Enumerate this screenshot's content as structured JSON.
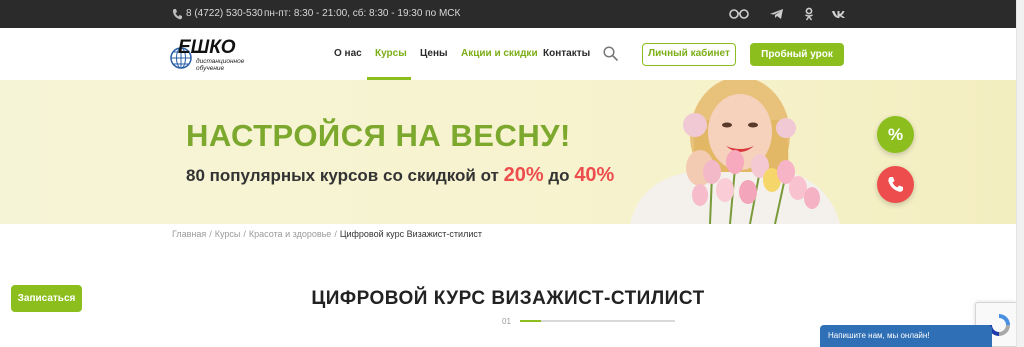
{
  "topbar": {
    "phone": "8 (4722) 530-530",
    "hours": "пн-пт: 8:30 - 21:00, сб: 8:30 - 19:30 по МСК",
    "social_icons": [
      "glasses-icon",
      "telegram-icon",
      "odnoklassniki-icon",
      "vk-icon"
    ]
  },
  "header": {
    "logo_text": "ЕШКО",
    "logo_sub1": "дистанционное",
    "logo_sub2": "обучение",
    "nav": [
      {
        "label": "О нас"
      },
      {
        "label": "Курсы",
        "active": true
      },
      {
        "label": "Цены"
      },
      {
        "label": "Акции и скидки"
      },
      {
        "label": "Контакты"
      }
    ],
    "cabinet_label": "Личный кабинет",
    "trial_label": "Пробный урок"
  },
  "banner": {
    "title": "НАСТРОЙСЯ НА ВЕСНУ!",
    "sub_prefix": "80 популярных курсов со скидкой от",
    "from_pct": "20%",
    "sub_mid": "до",
    "to_pct": "40%"
  },
  "fab": {
    "percent_label": "%"
  },
  "breadcrumbs": {
    "items": [
      "Главная",
      "Курсы",
      "Красота и здоровье"
    ],
    "separator": "/",
    "current": "Цифровой курс Визажист-стилист"
  },
  "enroll_label": "Записаться",
  "course": {
    "title": "ЦИФРОВОЙ КУРС ВИЗАЖИСТ-СТИЛИСТ",
    "step": "01"
  },
  "chat": {
    "label": "Напишите нам, мы онлайн!"
  },
  "colors": {
    "accent": "#8cbf1e",
    "accent_text": "#7cae17",
    "red": "#ee4d4d",
    "topbar": "#2b2b2b",
    "chat": "#2f6fb5"
  }
}
